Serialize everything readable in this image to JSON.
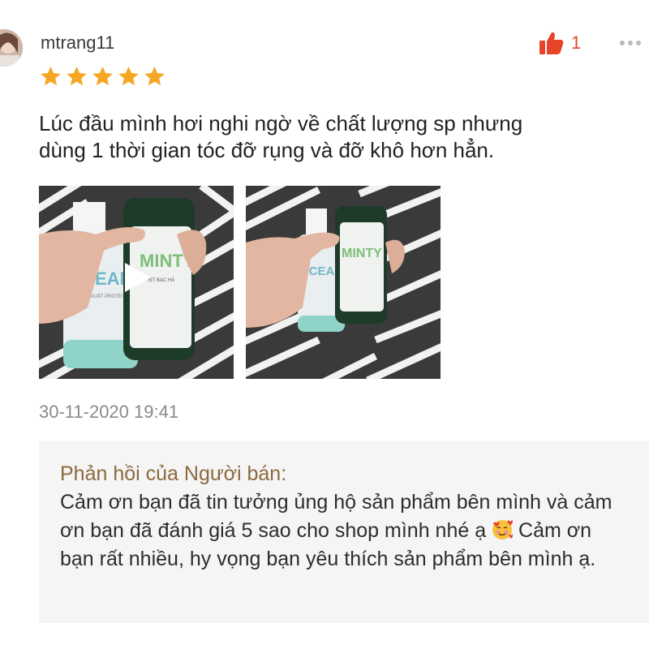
{
  "review": {
    "username": "mtrang11",
    "rating": 5,
    "like_count": "1",
    "comment_line1": "Lúc đầu mình hơi nghi ngờ về chất lượng sp nhưng",
    "comment_line2": "dùng 1 thời gian tóc đỡ rụng và đỡ khô hơn hẳn.",
    "timestamp": "30-11-2020 19:41",
    "media": [
      {
        "type": "video",
        "bottle_left": "OCEAN",
        "bottle_left_sub": "CHIẾT XUẤT PROTEIN",
        "bottle_right": "MINTY",
        "bottle_right_sub": "XỊT BẠC HÀ"
      },
      {
        "type": "image",
        "bottle_left": "OCEAN",
        "bottle_right": "MINTY"
      }
    ]
  },
  "seller_reply": {
    "title": "Phản hồi của Người bán:",
    "text_part1": "Cảm ơn bạn đã tin tưởng ủng hộ sản phẩm bên mình và cảm ơn bạn đã đánh giá 5 sao cho shop mình nhé ạ",
    "emoji": "smiling-face-with-hearts",
    "text_part2": " Cảm ơn bạn rất nhiều, hy vọng bạn yêu thích sản phẩm bên mình ạ."
  },
  "colors": {
    "star": "#f5a623",
    "like": "#e8442a",
    "reply_title": "#8b6a3e",
    "reply_bg": "#f5f5f5"
  }
}
